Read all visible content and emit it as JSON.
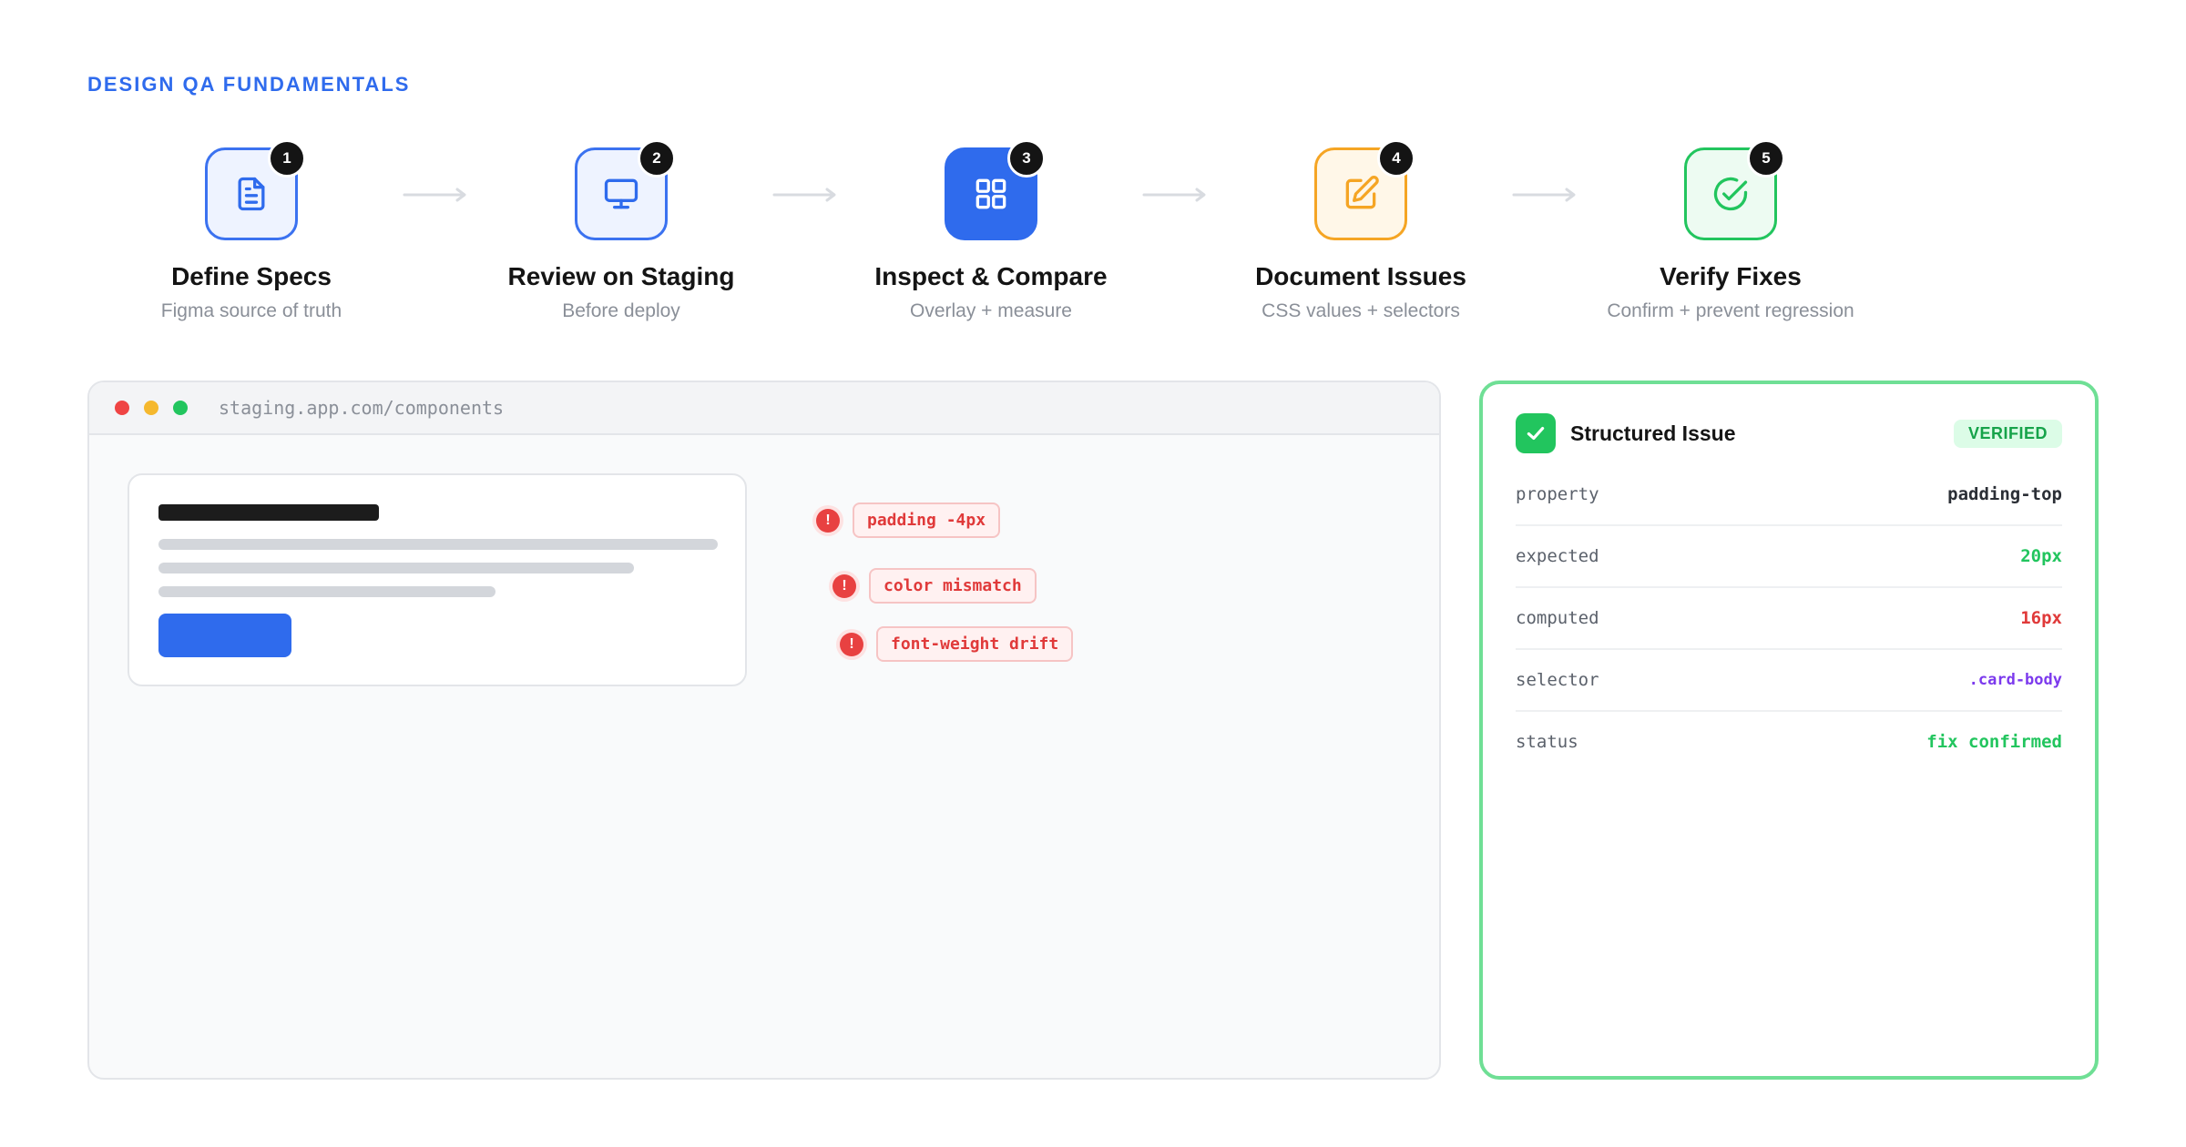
{
  "header": {
    "title": "DESIGN QA FUNDAMENTALS"
  },
  "steps": [
    {
      "number": "1",
      "title": "Define Specs",
      "subtitle": "Figma source of truth",
      "icon": "document-icon"
    },
    {
      "number": "2",
      "title": "Review on Staging",
      "subtitle": "Before deploy",
      "icon": "monitor-icon"
    },
    {
      "number": "3",
      "title": "Inspect & Compare",
      "subtitle": "Overlay + measure",
      "icon": "grid-icon"
    },
    {
      "number": "4",
      "title": "Document Issues",
      "subtitle": "CSS values + selectors",
      "icon": "edit-icon"
    },
    {
      "number": "5",
      "title": "Verify Fixes",
      "subtitle": "Confirm + prevent regression",
      "icon": "check-circle-icon"
    }
  ],
  "browser": {
    "url": "staging.app.com/components",
    "issues": [
      "padding -4px",
      "color mismatch",
      "font-weight drift"
    ]
  },
  "panel": {
    "title": "Structured Issue",
    "badge": "VERIFIED",
    "rows": [
      {
        "key": "property",
        "value": "padding-top"
      },
      {
        "key": "expected",
        "value": "20px"
      },
      {
        "key": "computed",
        "value": "16px"
      },
      {
        "key": "selector",
        "value": ".card-body"
      },
      {
        "key": "status",
        "value": "fix confirmed"
      }
    ]
  },
  "colors": {
    "accent_blue": "#2f6bed",
    "amber": "#f5a524",
    "green": "#22c55e",
    "error_red": "#e84141",
    "selector_purple": "#7c3aed"
  }
}
